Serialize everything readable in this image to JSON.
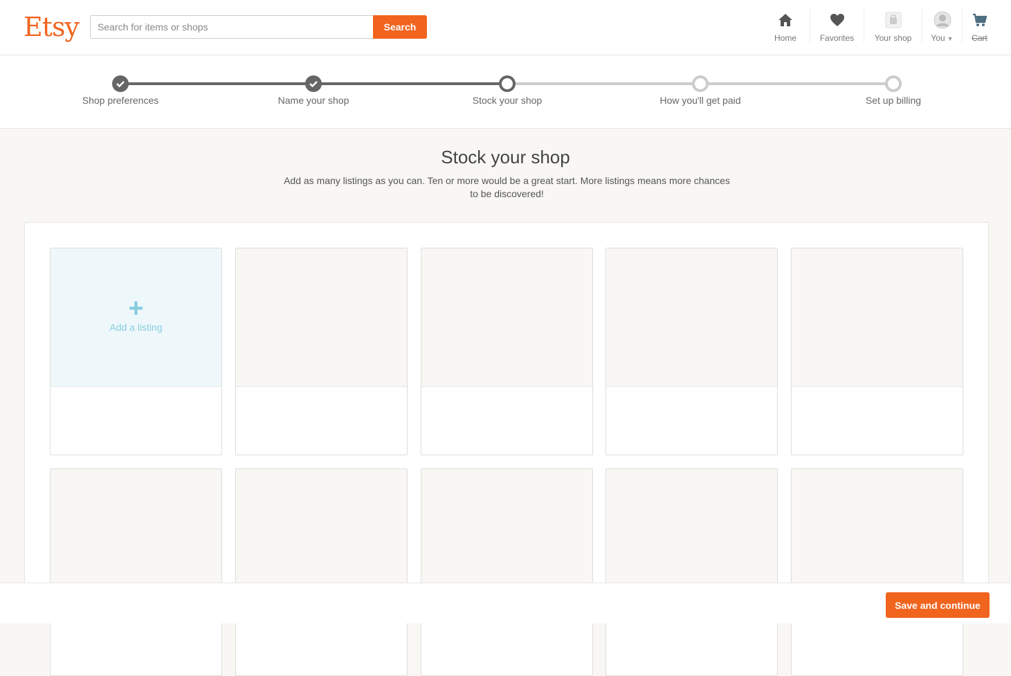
{
  "header": {
    "logo": "Etsy",
    "search": {
      "placeholder": "Search for items or shops",
      "button_label": "Search"
    },
    "nav": [
      {
        "label": "Home",
        "icon": "home-icon"
      },
      {
        "label": "Favorites",
        "icon": "heart-icon"
      },
      {
        "label": "Your shop",
        "icon": "shop-icon"
      },
      {
        "label": "You",
        "icon": "avatar-icon"
      },
      {
        "label": "Cart",
        "icon": "cart-icon"
      }
    ]
  },
  "progress": {
    "steps": [
      {
        "label": "Shop preferences",
        "state": "done"
      },
      {
        "label": "Name your shop",
        "state": "done"
      },
      {
        "label": "Stock your shop",
        "state": "current"
      },
      {
        "label": "How you'll get paid",
        "state": "future"
      },
      {
        "label": "Set up billing",
        "state": "future"
      }
    ]
  },
  "main": {
    "title": "Stock your shop",
    "subtitle": "Add as many listings as you can. Ten or more would be a great start. More listings means more chances to be discovered!",
    "add_listing_label": "Add a listing"
  },
  "footer": {
    "save_label": "Save and continue"
  },
  "colors": {
    "brand": "#f1641e",
    "accent": "#88ccdd",
    "step_done": "#666666",
    "step_future": "#cccccc"
  }
}
